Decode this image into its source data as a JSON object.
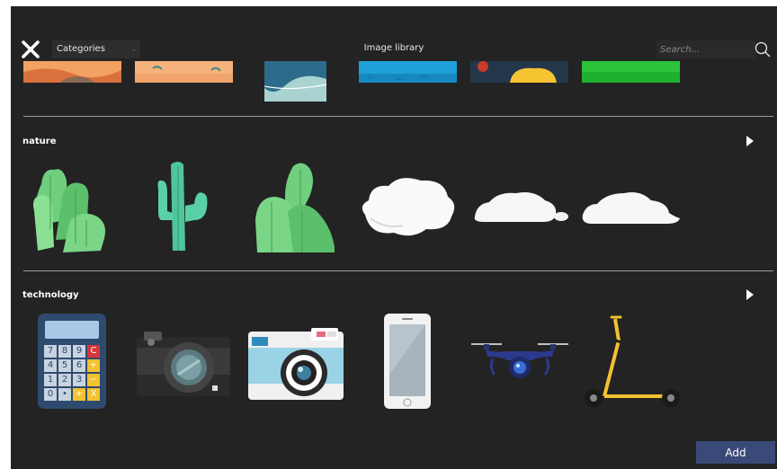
{
  "header": {
    "categories_label": "Categories",
    "title": "Image library",
    "search_placeholder": "Search..."
  },
  "sections": [
    {
      "title": "nature"
    },
    {
      "title": "technology"
    }
  ],
  "calculator_keys": [
    "7",
    "8",
    "9",
    "C",
    "4",
    "5",
    "6",
    "+",
    "1",
    "2",
    "3",
    "−",
    "0",
    "•",
    "+",
    "X"
  ],
  "footer": {
    "add_label": "Add"
  }
}
